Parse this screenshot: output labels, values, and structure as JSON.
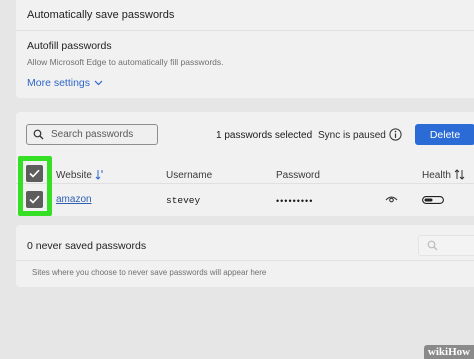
{
  "autosave": {
    "label": "Automatically save passwords"
  },
  "autofill": {
    "title": "Autofill passwords",
    "description": "Allow Microsoft Edge to automatically fill passwords.",
    "more_settings": "More settings"
  },
  "passwords": {
    "search_placeholder": "Search passwords",
    "selected_count": "1 passwords selected",
    "sync_status": "Sync is paused",
    "delete_label": "Delete",
    "columns": {
      "website": "Website",
      "username": "Username",
      "password": "Password",
      "health": "Health"
    },
    "rows": [
      {
        "website": "amazon",
        "username": "stevey",
        "password": "•••••••••",
        "checked": true
      }
    ],
    "select_all_checked": true
  },
  "never_saved": {
    "title": "0 never saved passwords",
    "description": "Sites where you choose to never save passwords will appear here"
  },
  "watermark": "wikiHow",
  "colors": {
    "accent": "#2b6bd5",
    "link": "#2f66c8",
    "highlight": "#35e024",
    "checkbox": "#5d5d5d"
  },
  "icons": [
    "search-icon",
    "chevron-down-icon",
    "info-icon",
    "sort-icon",
    "checkmark-icon",
    "eye-icon",
    "health-bar-icon"
  ]
}
